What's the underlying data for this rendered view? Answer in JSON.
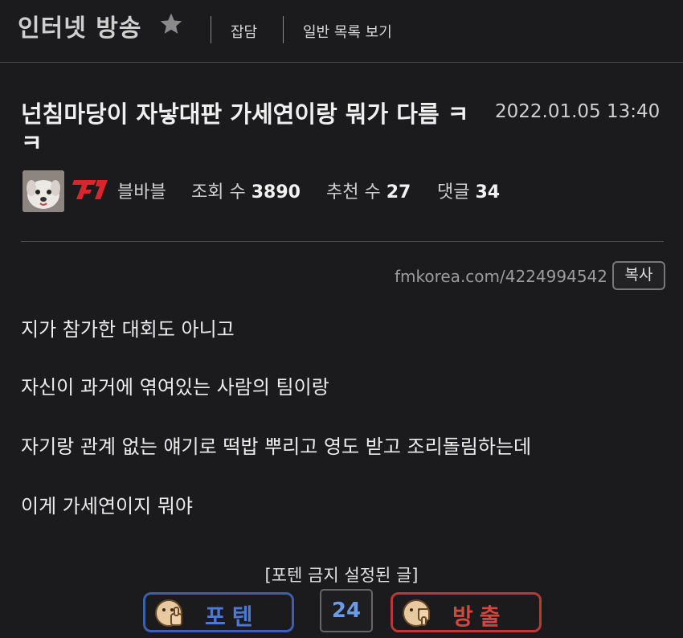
{
  "header": {
    "board_title": "인터넷 방송",
    "nav": {
      "chat_label": "잡담",
      "list_label": "일반 목록 보기"
    }
  },
  "post": {
    "title": "넌침마당이 자낳대판 가세연이랑 뭐가 다름 ㅋㅋ",
    "date": "2022.01.05 13:40",
    "author": "블바블",
    "views_label": "조회 수",
    "views": "3890",
    "recommend_label": "추천 수",
    "recommend": "27",
    "comments_label": "댓글",
    "comments": "34",
    "url": "fmkorea.com/4224994542",
    "copy_label": "복사",
    "content": [
      "지가 참가한 대회도 아니고",
      "자신이 과거에 엮여있는 사람의 팀이랑",
      "자기랑 관계 없는 얘기로 떡밥 뿌리고 영도 받고 조리돌림하는데",
      "이게 가세연이지 뭐야"
    ]
  },
  "voting": {
    "notice": "[포텐 금지 설정된 글]",
    "up_label": "포텐",
    "count": "24",
    "down_label": "방출"
  },
  "colors": {
    "background": "#1b1b1d",
    "up_accent": "#3d5fb0",
    "down_accent": "#b83a34",
    "count": "#6a9ae8"
  },
  "icons": {
    "star": "star-icon",
    "team_logo": "t1-logo-icon",
    "thumb_up": "thumb-up-icon",
    "thumb_down": "thumb-down-icon"
  }
}
